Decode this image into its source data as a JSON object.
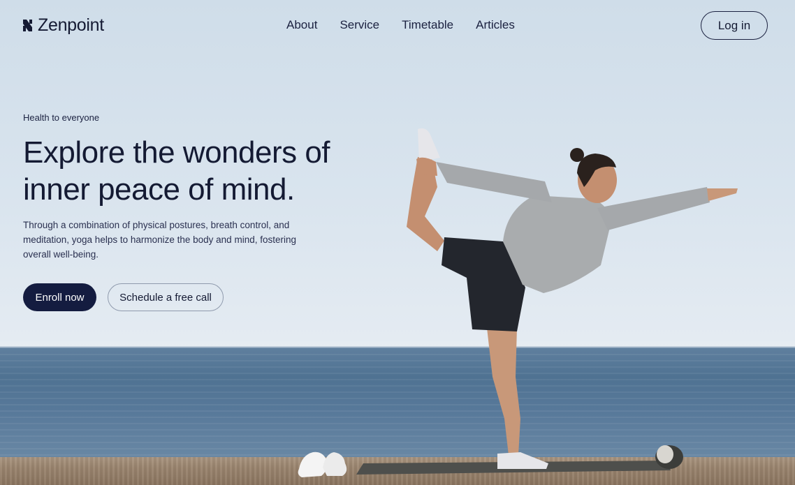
{
  "brand": {
    "name": "Zenpoint",
    "logo_icon": "zenpoint-logo-icon"
  },
  "nav": {
    "items": [
      {
        "label": "About"
      },
      {
        "label": "Service"
      },
      {
        "label": "Timetable"
      },
      {
        "label": "Articles"
      }
    ],
    "login_label": "Log in"
  },
  "hero": {
    "eyebrow": "Health to everyone",
    "headline_line1": "Explore the wonders of",
    "headline_line2": "inner peace of mind.",
    "description": "Through a combination of physical postures, breath control, and meditation, yoga helps to harmonize the body and mind, fostering overall well-being.",
    "primary_cta": "Enroll now",
    "secondary_cta": "Schedule a free call"
  },
  "colors": {
    "text": "#141a33",
    "primary_button": "#141c40",
    "sky": "#d9e4ee",
    "sea": "#4f7292",
    "sand": "#9a846e"
  }
}
